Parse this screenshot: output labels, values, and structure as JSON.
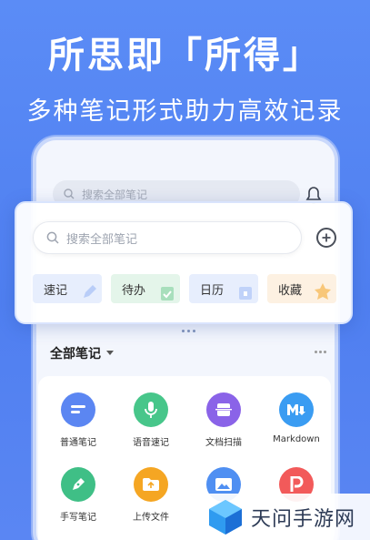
{
  "hero": {
    "headline": "所思即「所得」",
    "subline": "多种笔记形式助力高效记录"
  },
  "phone": {
    "search_placeholder": "搜索全部笔记"
  },
  "card": {
    "search_placeholder": "搜索全部笔记",
    "categories": [
      {
        "label": "速记",
        "bg": "#e7eefd",
        "icon": "pencil-icon"
      },
      {
        "label": "待办",
        "bg": "#e4f5ea",
        "icon": "clipboard-check-icon"
      },
      {
        "label": "日历",
        "bg": "#e7eefd",
        "icon": "calendar-icon"
      },
      {
        "label": "收藏",
        "bg": "#fdf1e2",
        "icon": "star-icon"
      }
    ]
  },
  "notes": {
    "section_title": "全部笔记",
    "tools": [
      {
        "label": "普通笔记",
        "color": "#5b86f2",
        "icon": "note-icon"
      },
      {
        "label": "语音速记",
        "color": "#47c68a",
        "icon": "microphone-icon"
      },
      {
        "label": "文档扫描",
        "color": "#8a63e8",
        "icon": "scan-icon"
      },
      {
        "label": "Markdown",
        "color": "#3a9cf2",
        "icon": "markdown-icon"
      },
      {
        "label": "手写笔记",
        "color": "#3fbf86",
        "icon": "pen-icon"
      },
      {
        "label": "上传文件",
        "color": "#f5a623",
        "icon": "folder-icon"
      },
      {
        "label": "",
        "color": "#4f8ff2",
        "icon": "image-icon"
      },
      {
        "label": "",
        "color": "#f25a5a",
        "icon": "p-icon"
      }
    ]
  },
  "watermark": {
    "text": "天问手游网"
  }
}
